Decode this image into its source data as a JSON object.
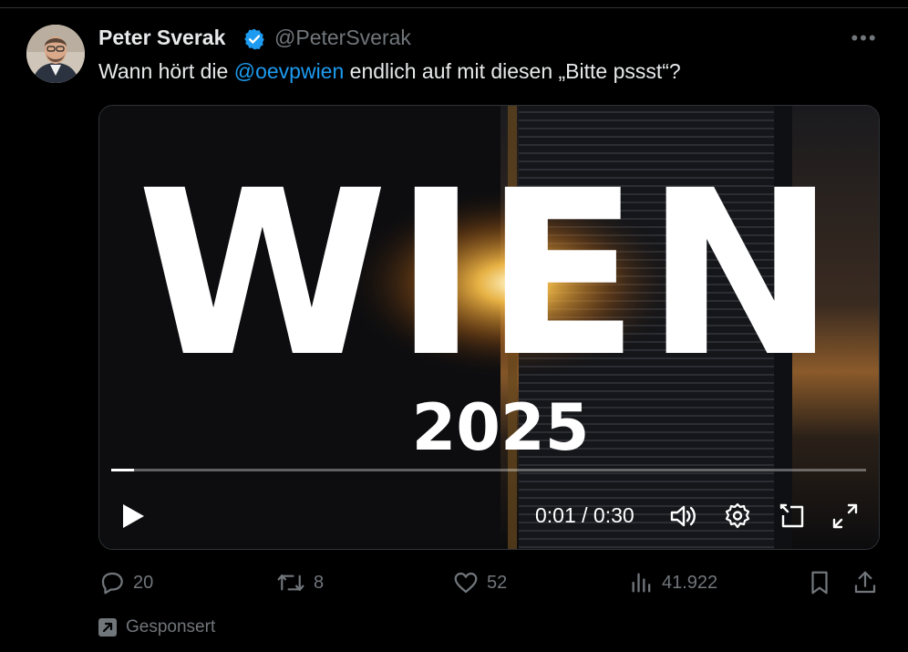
{
  "author": {
    "name": "Peter Sverak",
    "handle": "@PeterSverak",
    "verified": true
  },
  "post": {
    "text_before": "Wann hört die ",
    "mention": "@oevpwien",
    "text_after": " endlich auf mit diesen „Bitte pssst“?"
  },
  "video": {
    "title": "WIEN",
    "year": "2025",
    "time": "0:01 / 0:30",
    "progress": 0.03
  },
  "actions": {
    "replies": "20",
    "reposts": "8",
    "likes": "52",
    "views": "41.922"
  },
  "sponsored_label": "Gesponsert",
  "colors": {
    "accent": "#1d9bf0",
    "muted": "#71767b",
    "text": "#e7e9ea",
    "background": "#000000"
  }
}
